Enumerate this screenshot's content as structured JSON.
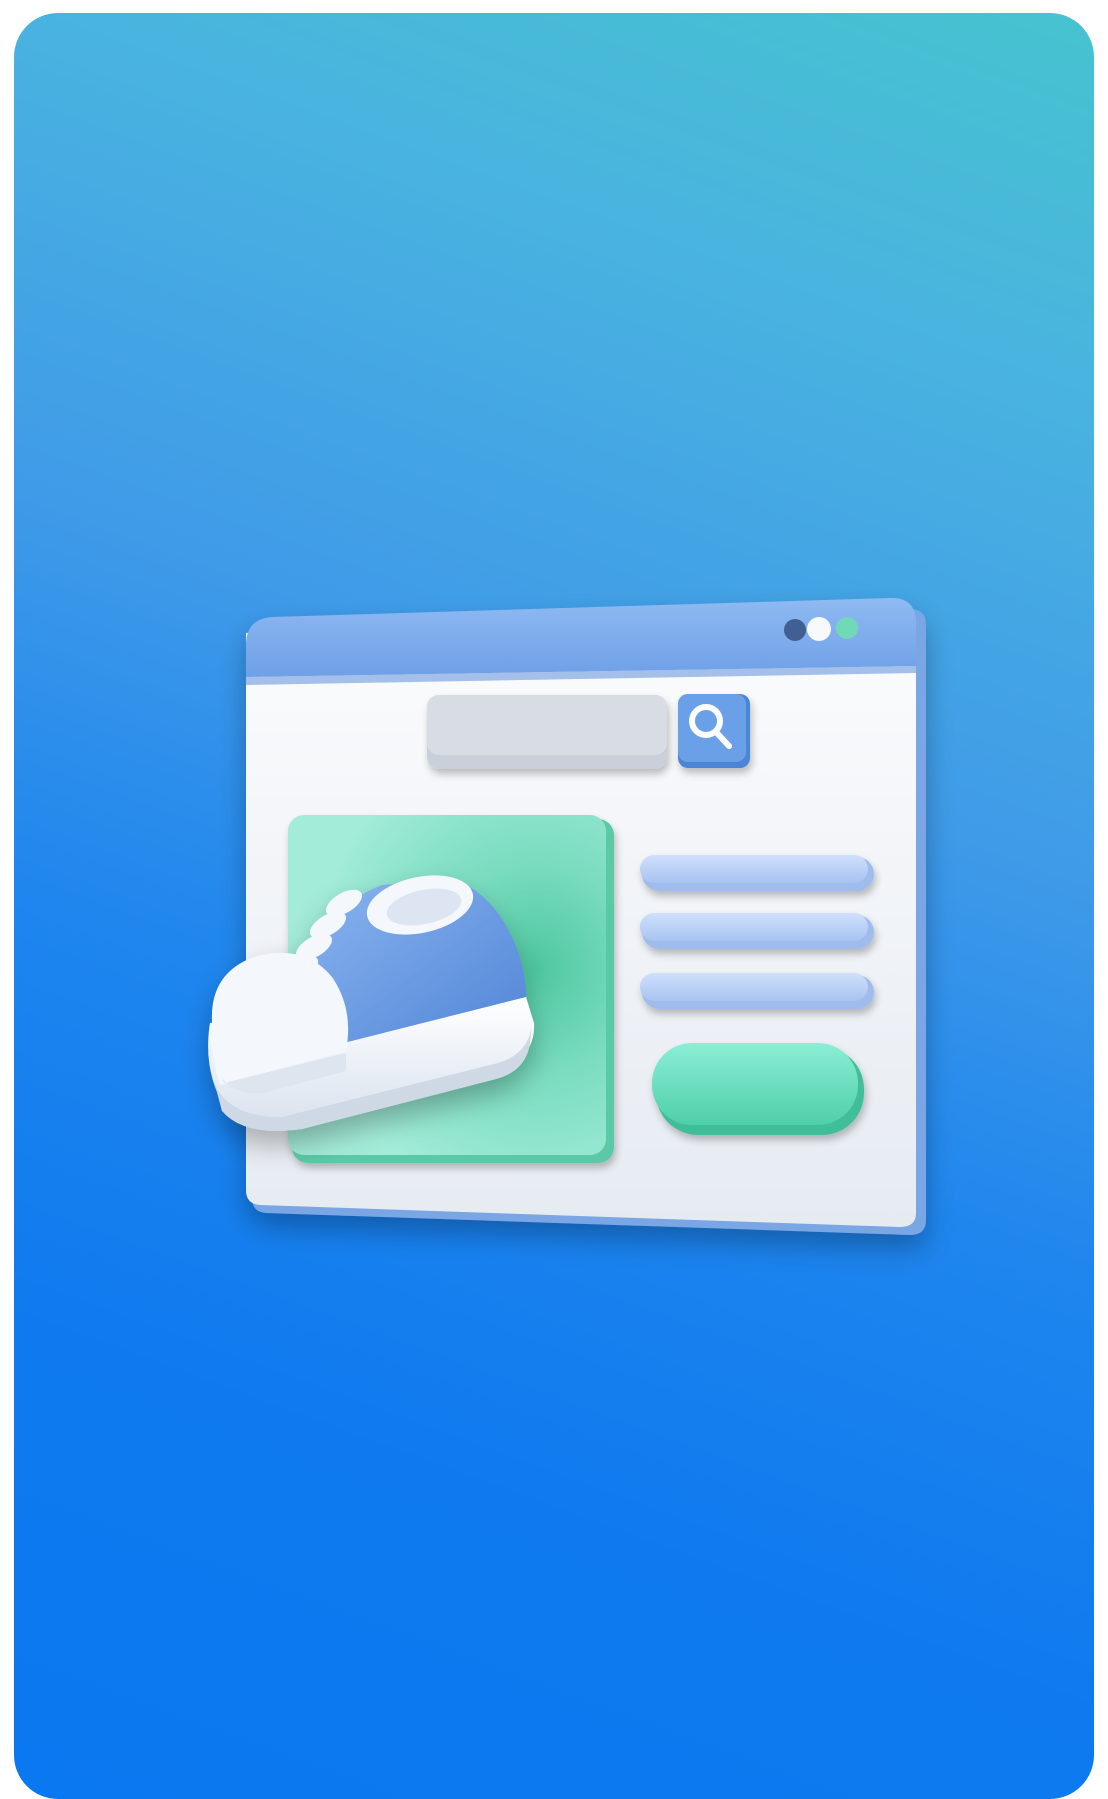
{
  "colors": {
    "background_top": "#46c3cf",
    "background_bottom": "#0a78f0",
    "window_titlebar": "#7fb0ef",
    "window_body": "#f4f6f9",
    "search_field": "#cdd3dc",
    "search_button": "#5c95e2",
    "product_image_panel": "#86e3c8",
    "text_line": "#b8d0f6",
    "action_button": "#6fe0c4",
    "shoe_upper": "#6a9be3",
    "shoe_sole": "#f3f6fb"
  },
  "illustration": {
    "window_controls": [
      "dark-dot",
      "white-dot",
      "green-dot"
    ],
    "icons": [
      "search-icon",
      "sneaker-icon"
    ],
    "text_lines_count": 3
  }
}
